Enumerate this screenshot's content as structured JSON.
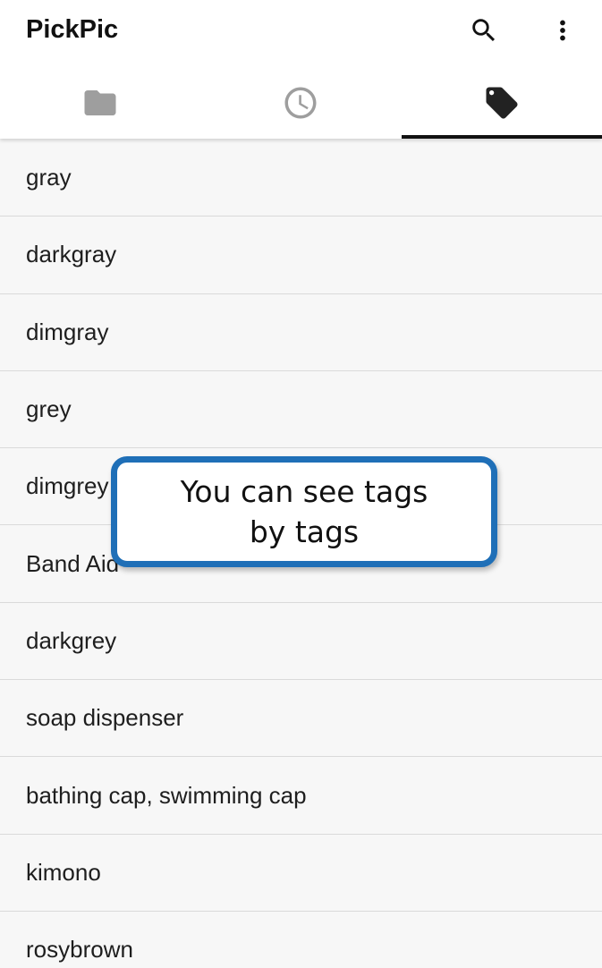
{
  "app": {
    "title": "PickPic"
  },
  "toolbar": {
    "search_icon": "search-icon",
    "more_icon": "more-vert-icon"
  },
  "tabs": [
    {
      "icon": "folder-icon",
      "selected": false
    },
    {
      "icon": "clock-icon",
      "selected": false
    },
    {
      "icon": "tag-icon",
      "selected": true
    }
  ],
  "tags": [
    "gray",
    "darkgray",
    "dimgray",
    "grey",
    "dimgrey",
    "Band Aid",
    "darkgrey",
    "soap dispenser",
    "bathing cap, swimming cap",
    "kimono",
    "rosybrown"
  ],
  "callout": {
    "line1": "You can see tags",
    "line2": "by tags"
  },
  "colors": {
    "accent": "#1f6fb7",
    "tab_inactive": "#9e9e9e",
    "tab_active": "#222222"
  }
}
